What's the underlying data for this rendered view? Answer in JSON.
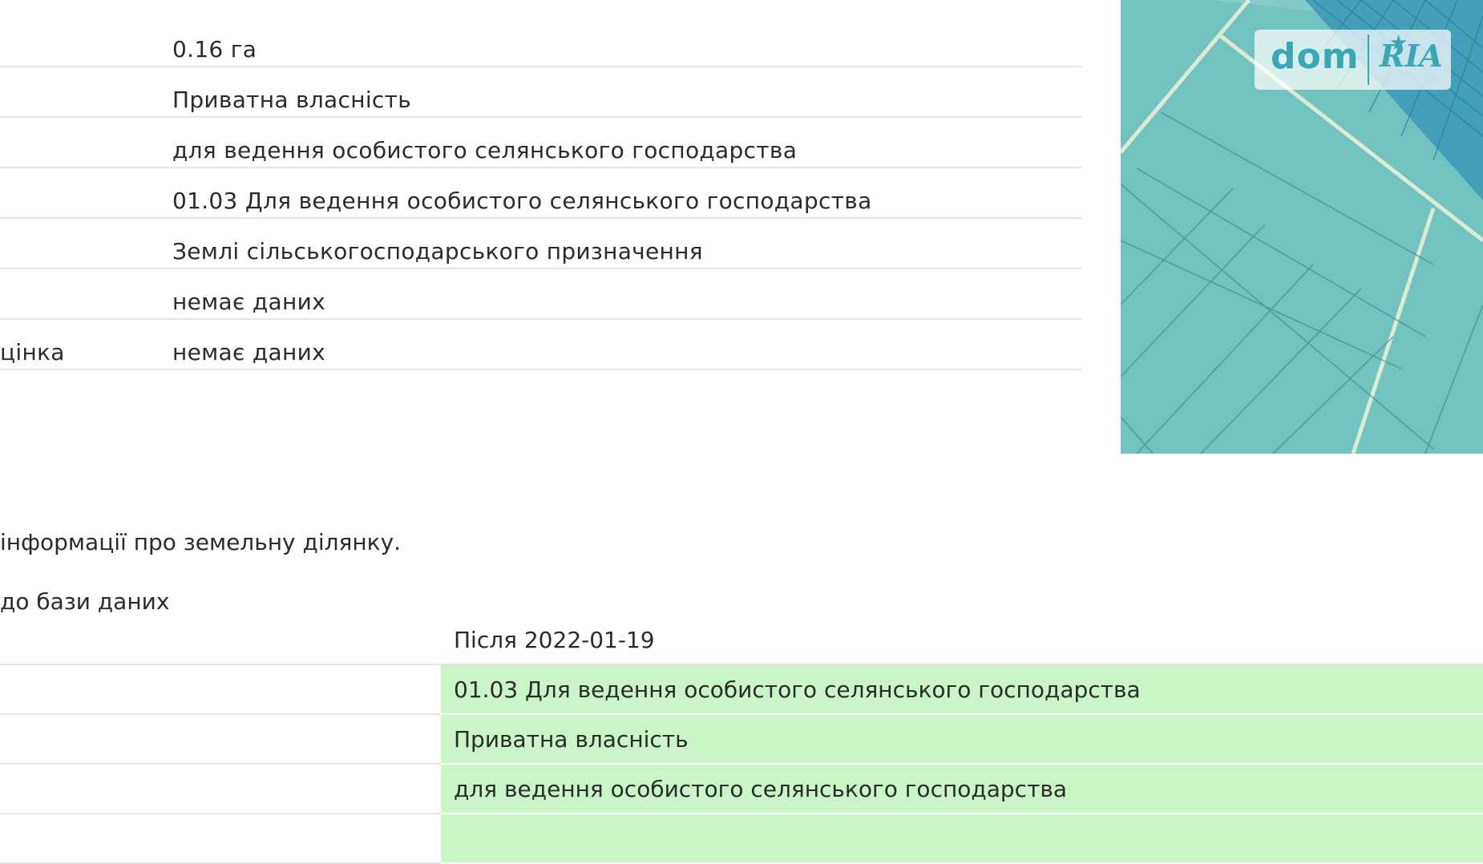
{
  "info_rows": [
    {
      "label": "",
      "value": "0.16 га"
    },
    {
      "label": "",
      "value": "Приватна власність"
    },
    {
      "label": "",
      "value": "для ведення особистого селянського господарства"
    },
    {
      "label": "",
      "value": "01.03 Для ведення особистого селянського господарства"
    },
    {
      "label": "",
      "value": "Землі сільськогосподарського призначення"
    },
    {
      "label": "",
      "value": "немає даних"
    },
    {
      "label": "цінка",
      "value": "немає даних"
    }
  ],
  "notes": {
    "info": "інформації про земельну ділянку.",
    "db": "до бази даних"
  },
  "changes": {
    "after_header": "Після 2022-01-19",
    "rows": [
      "01.03 Для ведення особистого селянського господарства",
      "Приватна власність",
      "для ведення особистого селянського господарства"
    ]
  },
  "watermark": {
    "dom": "dom",
    "ria": "RIA"
  },
  "colors": {
    "map_fill": "#6fbfbd",
    "highlight": "#c9f5c9",
    "watermark": "#3aa8b4"
  }
}
